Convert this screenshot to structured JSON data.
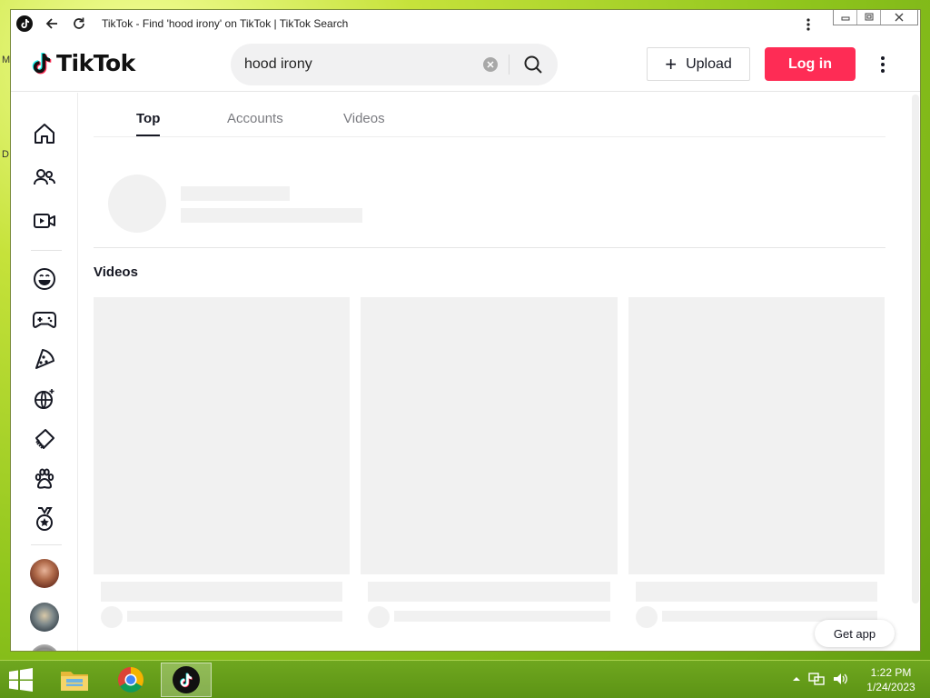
{
  "window": {
    "title": "TikTok - Find 'hood irony' on TikTok | TikTok Search"
  },
  "header": {
    "logo_text": "TikTok",
    "search": {
      "value": "hood irony",
      "placeholder": ""
    },
    "upload_label": "Upload",
    "login_label": "Log in"
  },
  "tabs": [
    {
      "label": "Top",
      "active": true
    },
    {
      "label": "Accounts",
      "active": false
    },
    {
      "label": "Videos",
      "active": false
    }
  ],
  "main": {
    "videos_heading": "Videos",
    "get_app_label": "Get app"
  },
  "sidebar": {
    "icons": [
      "home-icon",
      "following-icon",
      "live-icon",
      "comedy-icon",
      "gaming-icon",
      "food-icon",
      "dance-icon",
      "beauty-icon",
      "animals-icon",
      "sports-icon"
    ]
  },
  "taskbar": {
    "time": "1:22 PM",
    "date": "1/24/2023"
  },
  "colors": {
    "brand_red": "#fe2c55",
    "taskbar_green": "#6fa71f"
  }
}
